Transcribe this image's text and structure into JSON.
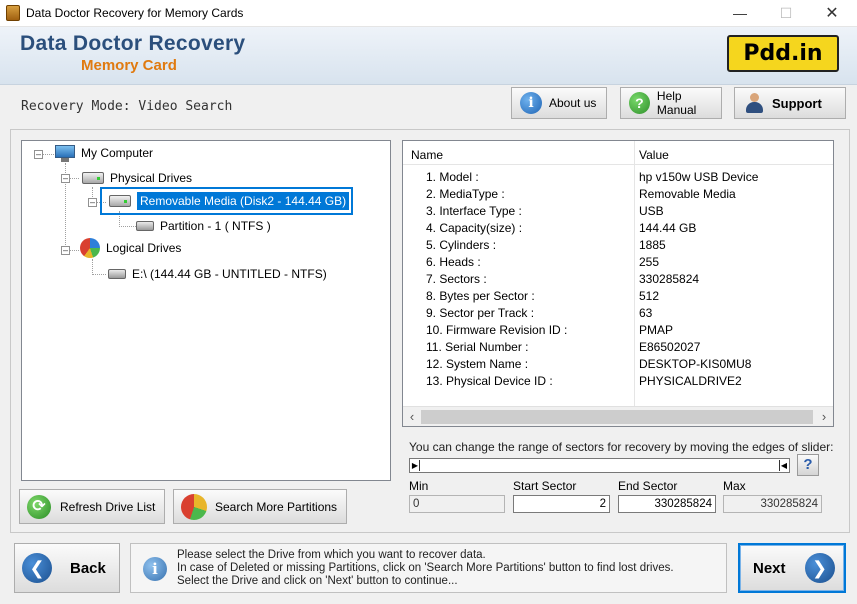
{
  "window": {
    "title": "Data Doctor Recovery for Memory Cards",
    "min_glyph": "—",
    "max_glyph": "☐",
    "close_glyph": "✕"
  },
  "header": {
    "brand_line1": "Data Doctor Recovery",
    "brand_line2": "Memory Card",
    "logo": "Pdd.in"
  },
  "mode": {
    "label": "Recovery Mode: Video Search"
  },
  "top_buttons": {
    "about": "About us",
    "help": "Help Manual",
    "support": "Support"
  },
  "tree": {
    "root": "My Computer",
    "physical": "Physical Drives",
    "removable": "Removable Media (Disk2 - 144.44 GB)",
    "partition": "Partition - 1 ( NTFS )",
    "logical": "Logical Drives",
    "volume": "E:\\ (144.44 GB - UNTITLED - NTFS)"
  },
  "properties": {
    "columns": {
      "name": "Name",
      "value": "Value"
    },
    "rows": [
      {
        "name": "1. Model :",
        "value": "hp v150w USB Device"
      },
      {
        "name": "2. MediaType :",
        "value": "Removable Media"
      },
      {
        "name": "3. Interface Type :",
        "value": "USB"
      },
      {
        "name": "4. Capacity(size) :",
        "value": "144.44 GB"
      },
      {
        "name": "5. Cylinders :",
        "value": "1885"
      },
      {
        "name": "6. Heads :",
        "value": "255"
      },
      {
        "name": "7. Sectors :",
        "value": "330285824"
      },
      {
        "name": "8. Bytes per Sector :",
        "value": "512"
      },
      {
        "name": "9. Sector per Track :",
        "value": "63"
      },
      {
        "name": "10. Firmware Revision ID :",
        "value": "PMAP"
      },
      {
        "name": "11. Serial Number :",
        "value": "E86502027"
      },
      {
        "name": "12. System Name :",
        "value": "DESKTOP-KIS0MU8"
      },
      {
        "name": "13. Physical Device ID :",
        "value": "PHYSICALDRIVE2"
      }
    ]
  },
  "slider": {
    "instruction": "You can change the range of sectors for recovery by moving the edges of slider:",
    "help_glyph": "?",
    "min_label": "Min",
    "min_value": "0",
    "start_label": "Start Sector",
    "start_value": "2",
    "end_label": "End Sector",
    "end_value": "330285824",
    "max_label": "Max",
    "max_value": "330285824"
  },
  "bottom_buttons": {
    "refresh": "Refresh Drive List",
    "search": "Search More Partitions"
  },
  "nav": {
    "back": "Back",
    "next": "Next"
  },
  "info": {
    "line1": "Please select the Drive from which you want to recover data.",
    "line2": "In case of Deleted or missing Partitions, click on 'Search More Partitions' button to find lost drives.",
    "line3": "Select the Drive and click on 'Next' button to continue..."
  }
}
